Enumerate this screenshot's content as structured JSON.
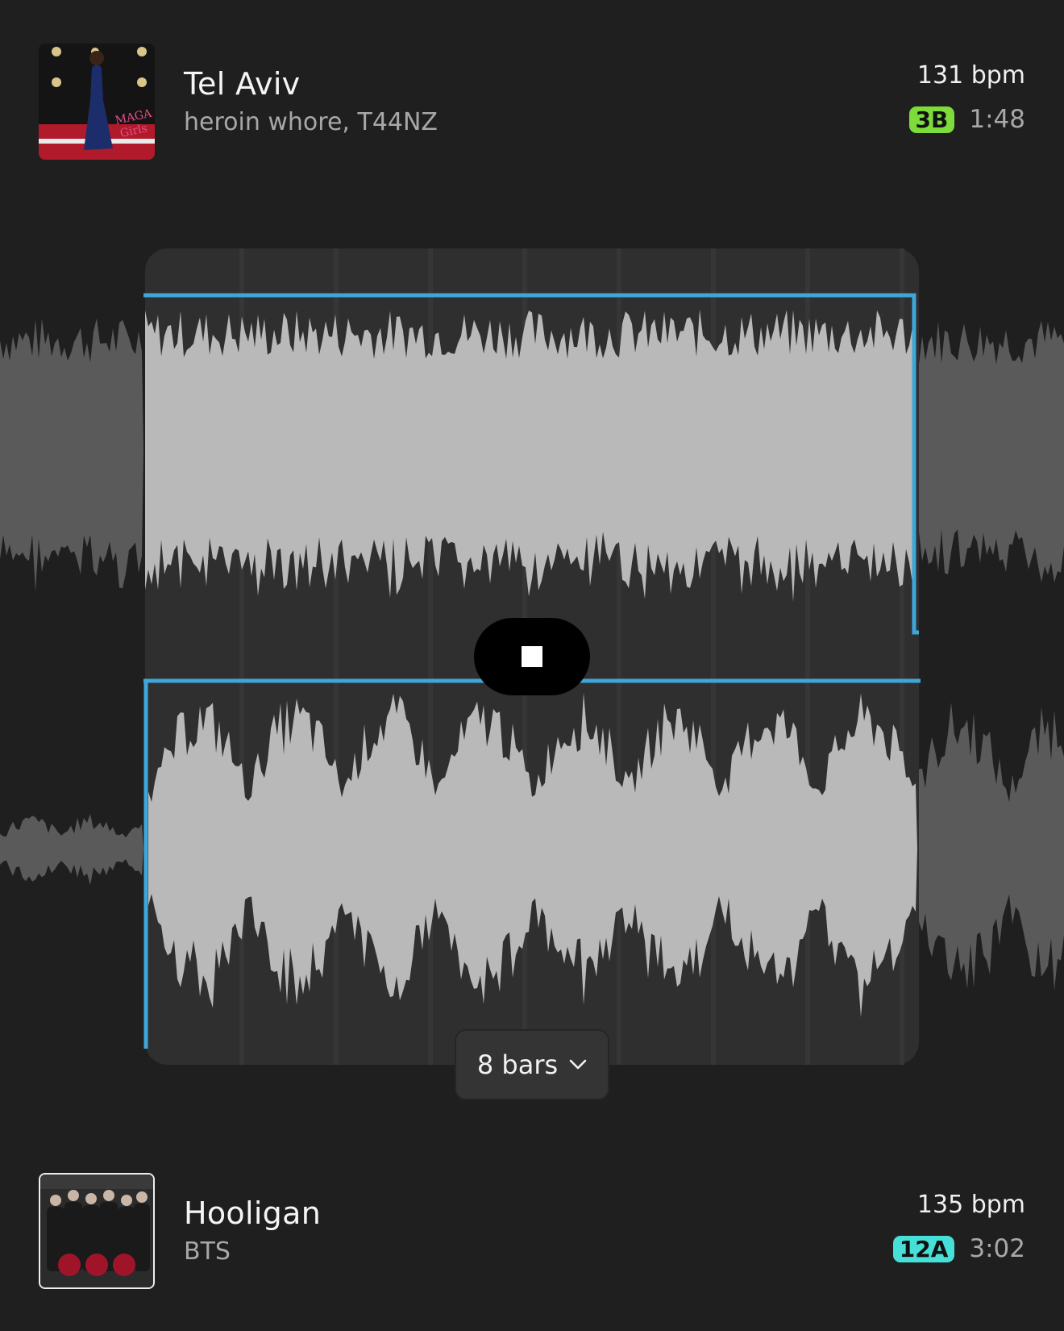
{
  "top_track": {
    "title": "Tel Aviv",
    "artist": "heroin whore, T44NZ",
    "bpm": "131 bpm",
    "key": "3B",
    "key_color": "#7ddc3a",
    "duration": "1:48",
    "art_icon": "album-art-grammys-red-carpet"
  },
  "bottom_track": {
    "title": "Hooligan",
    "artist": "BTS",
    "bpm": "135 bpm",
    "key": "12A",
    "key_color": "#46e0d8",
    "duration": "3:02",
    "art_icon": "album-art-group-photo"
  },
  "transport": {
    "stop_icon": "stop-icon"
  },
  "loop": {
    "bars_label": "8 bars",
    "chevron_icon": "chevron-down-icon",
    "accent": "#3fa6d8"
  }
}
